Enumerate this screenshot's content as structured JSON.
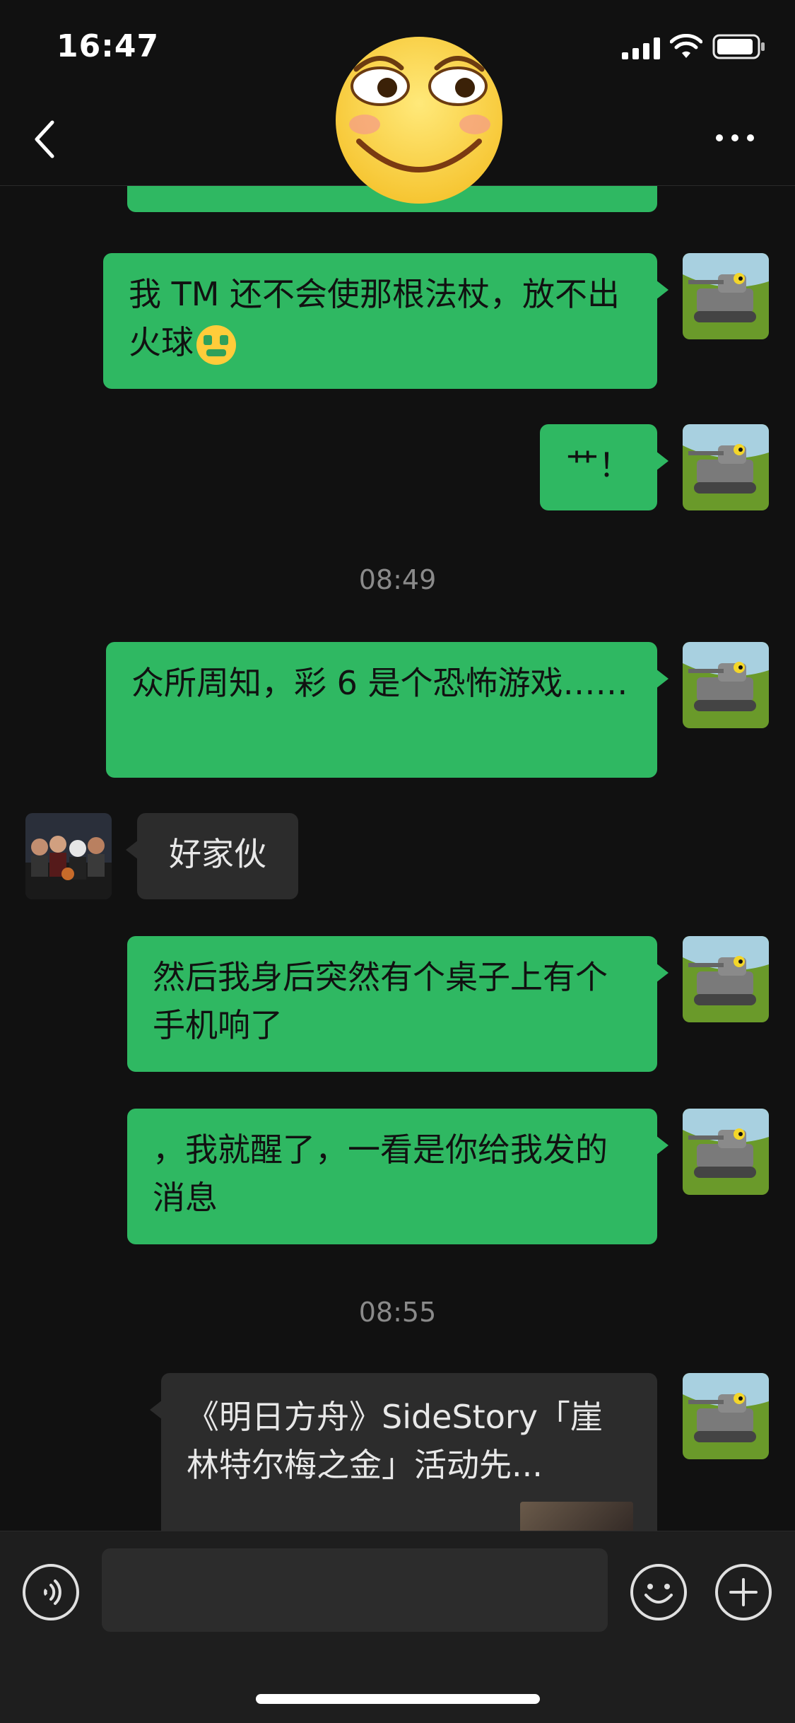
{
  "status_bar": {
    "time": "16:47"
  },
  "header": {
    "back_icon": "chevron-left-icon",
    "more_icon": "more-dots-icon",
    "sticker": "smirk-emoji-sticker"
  },
  "messages": [
    {
      "from": "me",
      "text": "我 TM 还不会使那根法杖，放不出火球",
      "emoji": "money-mouth-emoji"
    },
    {
      "from": "me",
      "text": "艹！"
    },
    {
      "type": "timestamp",
      "text": "08:49"
    },
    {
      "from": "me",
      "text": "众所周知，彩 6 是个恐怖游戏……"
    },
    {
      "from": "other",
      "text": "好家伙"
    },
    {
      "from": "me",
      "text": "然后我身后突然有个桌子上有个手机响了"
    },
    {
      "from": "me",
      "text": "，我就醒了，一看是你给我发的消息"
    },
    {
      "type": "timestamp",
      "text": "08:55"
    },
    {
      "from": "me",
      "type": "article",
      "title": "《明日方舟》SideStory「崖林特尔梅之金」活动先..."
    }
  ],
  "input_bar": {
    "voice_icon": "voice-icon",
    "emoji_icon": "smiley-icon",
    "plus_icon": "plus-icon",
    "placeholder": ""
  },
  "colors": {
    "accent": "#2fb862",
    "background": "#111111"
  }
}
